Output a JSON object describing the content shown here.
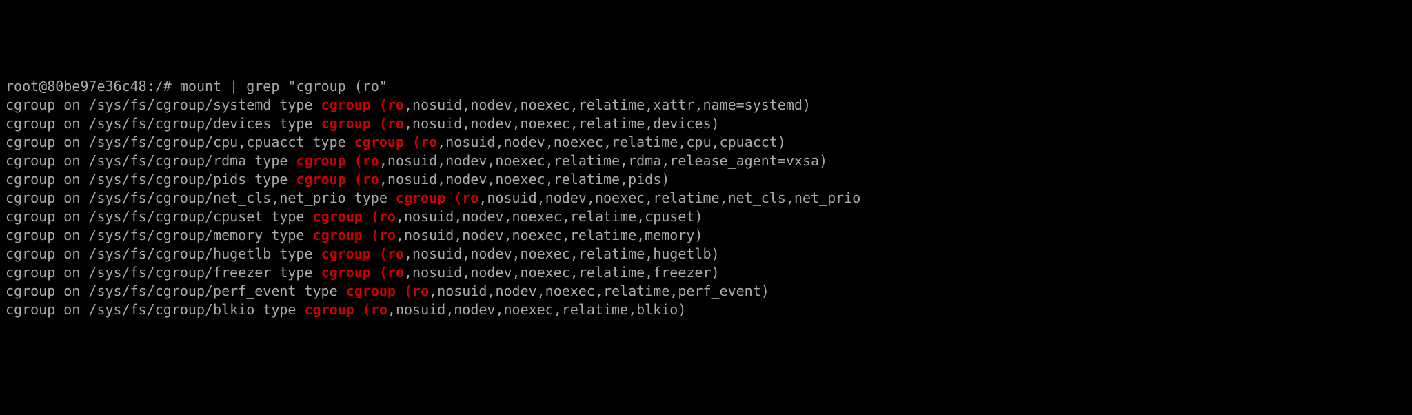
{
  "prompt": "root@80be97e36c48:/# ",
  "command": "mount | grep \"cgroup (ro\"",
  "highlight": "cgroup (ro",
  "lines": [
    {
      "before": "cgroup on /sys/fs/cgroup/systemd type ",
      "after": ",nosuid,nodev,noexec,relatime,xattr,name=systemd)"
    },
    {
      "before": "cgroup on /sys/fs/cgroup/devices type ",
      "after": ",nosuid,nodev,noexec,relatime,devices)"
    },
    {
      "before": "cgroup on /sys/fs/cgroup/cpu,cpuacct type ",
      "after": ",nosuid,nodev,noexec,relatime,cpu,cpuacct)"
    },
    {
      "before": "cgroup on /sys/fs/cgroup/rdma type ",
      "after": ",nosuid,nodev,noexec,relatime,rdma,release_agent=vxsa)"
    },
    {
      "before": "cgroup on /sys/fs/cgroup/pids type ",
      "after": ",nosuid,nodev,noexec,relatime,pids)"
    },
    {
      "before": "cgroup on /sys/fs/cgroup/net_cls,net_prio type ",
      "after": ",nosuid,nodev,noexec,relatime,net_cls,net_prio"
    },
    {
      "before": "cgroup on /sys/fs/cgroup/cpuset type ",
      "after": ",nosuid,nodev,noexec,relatime,cpuset)"
    },
    {
      "before": "cgroup on /sys/fs/cgroup/memory type ",
      "after": ",nosuid,nodev,noexec,relatime,memory)"
    },
    {
      "before": "cgroup on /sys/fs/cgroup/hugetlb type ",
      "after": ",nosuid,nodev,noexec,relatime,hugetlb)"
    },
    {
      "before": "cgroup on /sys/fs/cgroup/freezer type ",
      "after": ",nosuid,nodev,noexec,relatime,freezer)"
    },
    {
      "before": "cgroup on /sys/fs/cgroup/perf_event type ",
      "after": ",nosuid,nodev,noexec,relatime,perf_event)"
    },
    {
      "before": "cgroup on /sys/fs/cgroup/blkio type ",
      "after": ",nosuid,nodev,noexec,relatime,blkio)"
    }
  ]
}
